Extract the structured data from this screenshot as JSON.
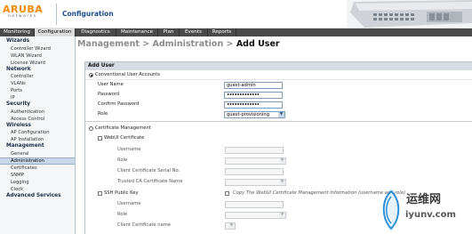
{
  "header": {
    "logo_main": "ARUBA",
    "logo_sub": "networks",
    "app_title": "Configuration"
  },
  "tabs": [
    {
      "label": "Monitoring",
      "active": false
    },
    {
      "label": "Configuration",
      "active": true
    },
    {
      "label": "Diagnostics",
      "active": false
    },
    {
      "label": "Maintenance",
      "active": false
    },
    {
      "label": "Plan",
      "active": false
    },
    {
      "label": "Events",
      "active": false
    },
    {
      "label": "Reports",
      "active": false
    }
  ],
  "sidebar": {
    "wizards": {
      "title": "Wizards",
      "items": [
        "Controller Wizard",
        "WLAN Wizard",
        "License Wizard"
      ]
    },
    "network": {
      "title": "Network",
      "items": [
        "Controller",
        "VLANs",
        "Ports",
        "IP"
      ]
    },
    "security": {
      "title": "Security",
      "items": [
        "Authentication",
        "Access Control"
      ]
    },
    "wireless": {
      "title": "Wireless",
      "items": [
        "AP Configuration",
        "AP Installation"
      ]
    },
    "management": {
      "title": "Management",
      "items": [
        "General",
        "Administration",
        "Certificates",
        "SNMP",
        "Logging",
        "Clock"
      ]
    },
    "advanced": {
      "title": "Advanced Services"
    }
  },
  "breadcrumb": {
    "part1": "Management",
    "sep1": " > ",
    "part2": "Administration",
    "sep2": " > ",
    "current": "Add User"
  },
  "panel": {
    "title": "Add User",
    "conventional": {
      "label": "Conventional User Accounts",
      "selected": true,
      "user_name_label": "User Name",
      "user_name_value": "guest-admin",
      "password_label": "Password",
      "password_value": "•••••••••••••",
      "confirm_label": "Confirm Password",
      "confirm_value": "•••••••••••••",
      "role_label": "Role",
      "role_value": "guest-provisioning"
    },
    "certificate": {
      "label": "Certificate Management",
      "selected": false,
      "webui": {
        "label": "WebUI Certificate",
        "username_label": "Username",
        "role_label": "Role",
        "serial_label": "Client Certificate Serial No.",
        "trusted_label": "Trusted CA Certificate Name"
      },
      "ssh": {
        "label": "SSH Public Key",
        "copy_label": "Copy The WebUI Certificate Management Information (username and role)",
        "username_label": "Username",
        "role_label": "Role",
        "client_cert_label": "Client Certificate name"
      }
    }
  },
  "watermark": {
    "cn_text": "运维网",
    "url_text": "iyunv.com"
  },
  "colors": {
    "brand_orange": "#f18a00",
    "tab_bar": "#4a4a4a",
    "panel_header": "#d7dce4",
    "selected_item": "#c9d7ea",
    "title_blue": "#1d4e8c"
  }
}
